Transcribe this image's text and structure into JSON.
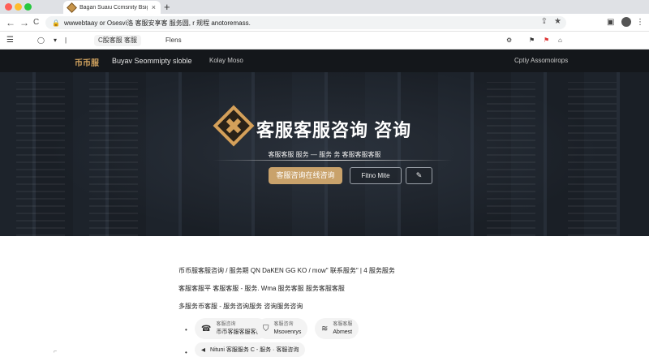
{
  "browser": {
    "tab_title": "Bagan Suaiu Ccmsnity Bsign",
    "tab_close": "×",
    "new_tab": "+",
    "url": "wwwebtaay or Osesvi洛 客服安享客 服务圆, r 规程 anotoremass.",
    "back": "←",
    "forward": "→",
    "reload": "C",
    "lock": "🔒",
    "bookmarks": {
      "menu": "☰",
      "chat": "◯",
      "field_a": "C股客服 客服",
      "field_b": "Flens"
    }
  },
  "site": {
    "logo": "币币服",
    "name": "Buyav Seommipty sloble",
    "nav_link": "Kolay Moso",
    "nav_right": "Cptiy Assomoirops",
    "hero_title": "客服客服咨询 咨询",
    "hero_subtitle": "客服客服 服务 — 服务 务 客服客服客服",
    "btn_primary": "客服咨询在线咨询",
    "btn_secondary": "Fitno Mite",
    "btn_icon": "✎"
  },
  "content": {
    "line1": "币币服客服咨询 / 服务期 QN DaKEN GG KO / mow\" 联系服务\" | 4 服务服务",
    "line2": "客服客服平 客服客服 - 服务. Wma 服务客服 服务客服客服",
    "line3": "多服务币客服 - 服务咨询服务 咨询服务咨询",
    "chips": [
      {
        "small": "客服咨询",
        "main": "币币客服客服客服"
      },
      {
        "small": "客服咨询",
        "main": "Msovenrys"
      },
      {
        "small": "客服客服",
        "main": "Abmest"
      }
    ],
    "line4": "Nituni 客服服务 C - 服务 · 客服咨询"
  }
}
